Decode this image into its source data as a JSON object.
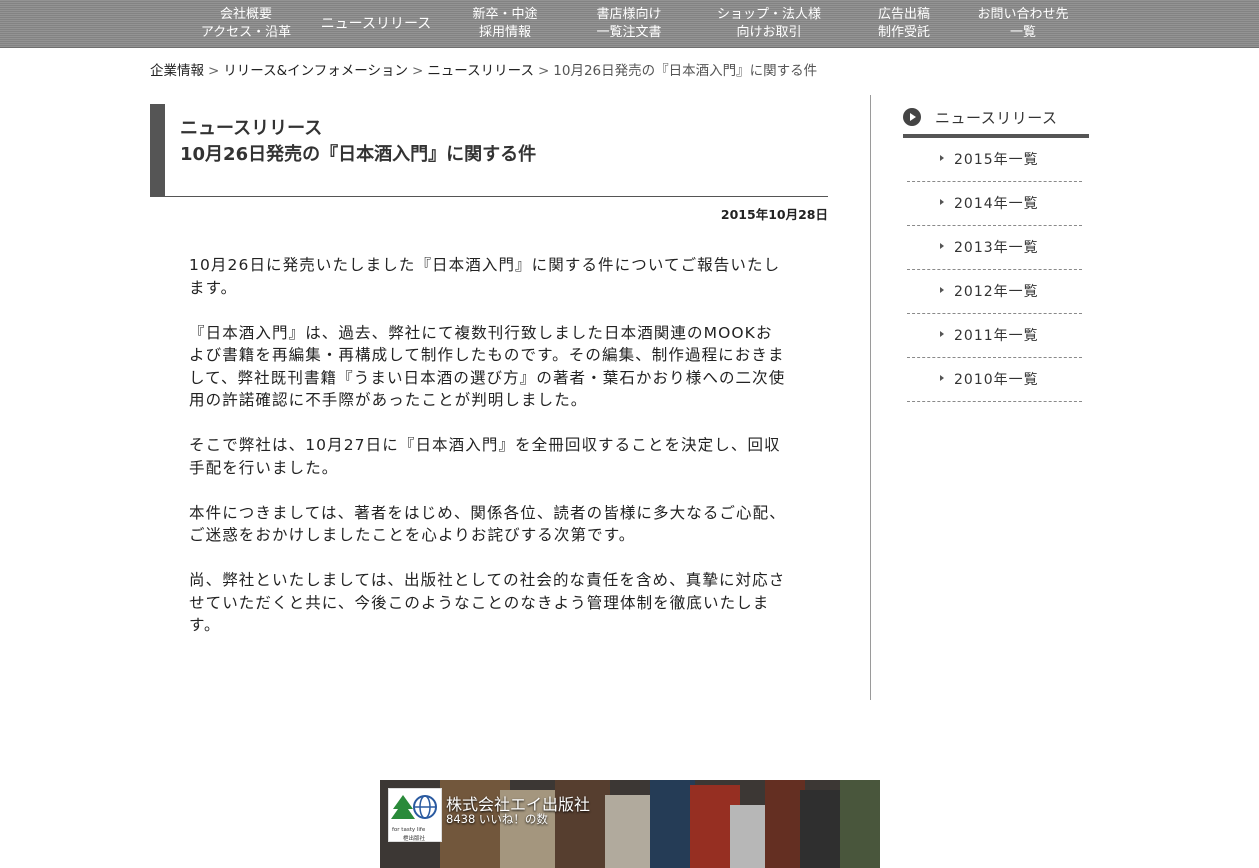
{
  "nav": {
    "items": [
      {
        "line1": "会社概要",
        "line2": "アクセス・沿革"
      },
      {
        "line1": "ニュースリリース",
        "line2": ""
      },
      {
        "line1": "新卒・中途",
        "line2": "採用情報"
      },
      {
        "line1": "書店様向け",
        "line2": "一覧注文書"
      },
      {
        "line1": "ショップ・法人様",
        "line2": "向けお取引"
      },
      {
        "line1": "広告出稿",
        "line2": "制作受託"
      },
      {
        "line1": "お問い合わせ先",
        "line2": "一覧"
      }
    ]
  },
  "breadcrumb": {
    "items": [
      "企業情報",
      "リリース&インフォメーション",
      "ニュースリリース"
    ],
    "separator": ">",
    "current": "10月26日発売の『日本酒入門』に関する件"
  },
  "article": {
    "category": "ニュースリリース",
    "title": "10月26日発売の『日本酒入門』に関する件",
    "date": "2015年10月28日",
    "paragraphs": [
      "10月26日に発売いたしました『日本酒入門』に関する件についてご報告いたします。",
      "『日本酒入門』は、過去、弊社にて複数刊行致しました日本酒関連のMOOKおよび書籍を再編集・再構成して制作したものです。その編集、制作過程におきまして、弊社既刊書籍『うまい日本酒の選び方』の著者・葉石かおり様への二次使用の許諾確認に不手際があったことが判明しました。",
      "そこで弊社は、10月27日に『日本酒入門』を全冊回収することを決定し、回収手配を行いました。",
      "本件につきましては、著者をはじめ、関係各位、読者の皆様に多大なるご心配、ご迷惑をおかけしましたことを心よりお詫びする次第です。",
      "尚、弊社といたしましては、出版社としての社会的な責任を含め、真摯に対応させていただくと共に、今後このようなことのなきよう管理体制を徹底いたします。"
    ]
  },
  "sidebar": {
    "heading": "ニュースリリース",
    "items": [
      "2015年一覧",
      "2014年一覧",
      "2013年一覧",
      "2012年一覧",
      "2011年一覧",
      "2010年一覧"
    ]
  },
  "facebook": {
    "page_name": "株式会社エイ出版社",
    "likes": "8438 いいね！の数",
    "logo_tagline": "for tasty life",
    "logo_name": "枻出版社"
  },
  "colors": {
    "nav_bg": "#8a8a8a",
    "header_accent": "#555555",
    "text": "#222222"
  }
}
